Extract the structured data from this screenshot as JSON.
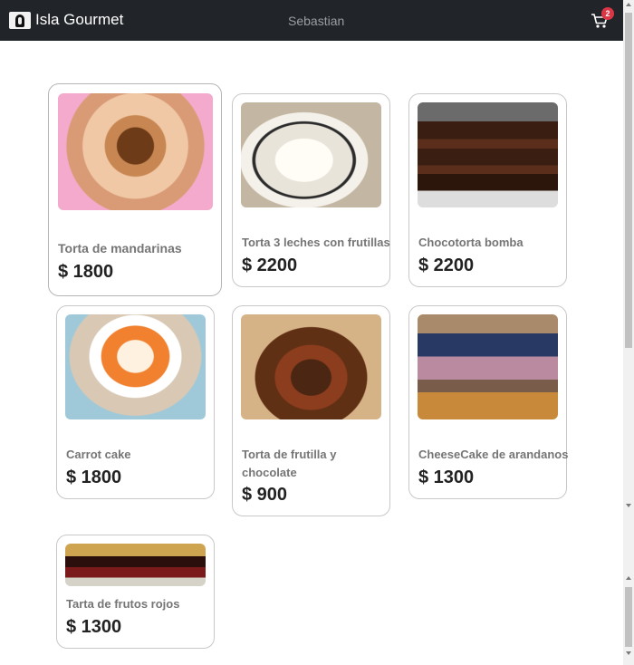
{
  "navbar": {
    "brand_name": "Isla Gourmet",
    "user_name": "Sebastian",
    "cart_count": "2"
  },
  "products": [
    {
      "name": "Torta de mandarinas",
      "price": "$ 1800"
    },
    {
      "name": "Torta 3 leches con frutillas",
      "price": "$ 2200"
    },
    {
      "name": "Chocotorta bomba",
      "price": "$ 2200"
    },
    {
      "name": "Carrot cake",
      "price": "$ 1800"
    },
    {
      "name": "Torta de frutilla y chocolate",
      "price": "$ 900"
    },
    {
      "name": "CheeseCake de arandanos",
      "price": "$ 1300"
    },
    {
      "name": "Tarta de frutos rojos",
      "price": "$ 1300"
    }
  ],
  "icons": {
    "brand": "cake-mask-logo",
    "cart": "shopping-cart-icon"
  }
}
